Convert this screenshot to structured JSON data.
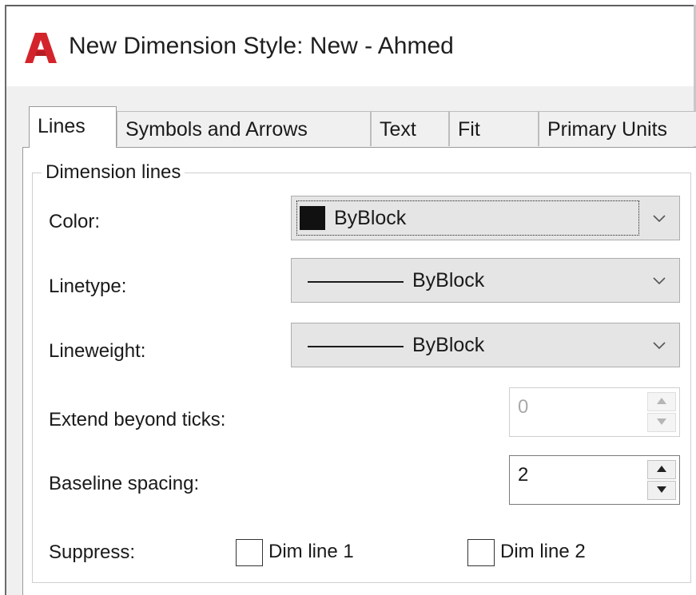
{
  "window": {
    "title": "New Dimension Style: New - Ahmed",
    "icon": "autocad-a-icon",
    "icon_color": "#d4242b"
  },
  "tabs": [
    {
      "label": "Lines",
      "active": true
    },
    {
      "label": "Symbols and Arrows",
      "active": false
    },
    {
      "label": "Text",
      "active": false
    },
    {
      "label": "Fit",
      "active": false
    },
    {
      "label": "Primary Units",
      "active": false
    }
  ],
  "dimension_lines": {
    "group_title": "Dimension lines",
    "color": {
      "label": "Color:",
      "value": "ByBlock",
      "swatch": "#111111"
    },
    "linetype": {
      "label": "Linetype:",
      "value": "ByBlock"
    },
    "lineweight": {
      "label": "Lineweight:",
      "value": "ByBlock"
    },
    "extend_beyond_ticks": {
      "label": "Extend beyond ticks:",
      "value": "0",
      "enabled": false
    },
    "baseline_spacing": {
      "label": "Baseline spacing:",
      "value": "2",
      "enabled": true
    },
    "suppress": {
      "label": "Suppress:",
      "dim_line_1": {
        "label": "Dim line 1",
        "checked": false
      },
      "dim_line_2": {
        "label": "Dim line 2",
        "checked": false
      }
    }
  }
}
